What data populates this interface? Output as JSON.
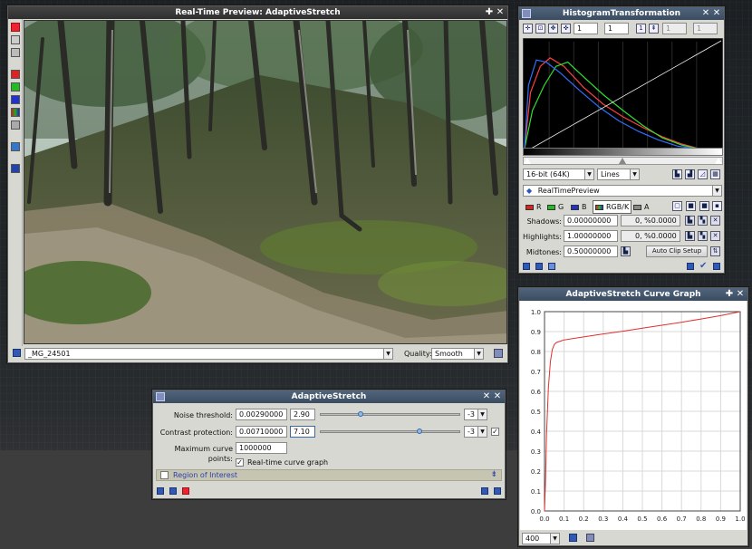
{
  "preview": {
    "title": "Real-Time Preview: AdaptiveStretch",
    "image_name": "_MG_24501",
    "quality_label": "Quality:",
    "quality_value": "Smooth"
  },
  "histogram": {
    "title": "HistogramTransformation",
    "zoom_h": "1",
    "zoom_v": "1",
    "zoom_h2": "1",
    "zoom_v2": "1",
    "bit_depth": "16-bit (64K)",
    "plot_mode": "Lines",
    "view": "RealTimePreview",
    "channels": [
      "R",
      "G",
      "B",
      "RGB/K",
      "A"
    ],
    "shadows_label": "Shadows:",
    "shadows_value": "0.00000000",
    "shadows_clip": "0, %0.0000",
    "highlights_label": "Highlights:",
    "highlights_value": "1.00000000",
    "highlights_clip": "0, %0.0000",
    "midtones_label": "Midtones:",
    "midtones_value": "0.50000000",
    "auto_clip_button": "Auto Clip Setup"
  },
  "adaptive": {
    "title": "AdaptiveStretch",
    "noise_label": "Noise threshold:",
    "noise_value": "0.00290000",
    "noise_mantissa": "2.90",
    "noise_exp": "-3",
    "noise_level": 0.29,
    "contrast_label": "Contrast protection:",
    "contrast_value": "0.00710000",
    "contrast_mantissa": "7.10",
    "contrast_exp": "-3",
    "contrast_level": 0.71,
    "max_points_label": "Maximum curve points:",
    "max_points_value": "1000000",
    "realtime_graph_label": "Real-time curve graph",
    "roi_label": "Region of Interest"
  },
  "curve_graph": {
    "title": "AdaptiveStretch Curve Graph",
    "size_value": "400",
    "y_ticks": [
      "1.0",
      "0.9",
      "0.8",
      "0.7",
      "0.6",
      "0.5",
      "0.4",
      "0.3",
      "0.2",
      "0.1",
      "0.0"
    ],
    "x_ticks": [
      "0.0",
      "0.1",
      "0.2",
      "0.3",
      "0.4",
      "0.5",
      "0.6",
      "0.7",
      "0.8",
      "0.9",
      "1.0"
    ],
    "curve_color": "#e03030"
  },
  "chart_data": {
    "type": "line",
    "title": "",
    "xlabel": "",
    "ylabel": "",
    "xlim": [
      0,
      1
    ],
    "ylim": [
      0,
      1
    ],
    "grid": true,
    "series": [
      {
        "x": [
          0.0,
          0.005,
          0.01,
          0.02,
          0.03,
          0.04,
          0.05,
          0.06,
          0.08,
          0.1,
          0.2,
          0.3,
          0.4,
          0.5,
          0.6,
          0.7,
          0.8,
          0.9,
          1.0
        ],
        "y": [
          0.0,
          0.15,
          0.38,
          0.62,
          0.75,
          0.81,
          0.835,
          0.845,
          0.852,
          0.858,
          0.873,
          0.888,
          0.902,
          0.917,
          0.932,
          0.947,
          0.963,
          0.98,
          1.0
        ]
      }
    ]
  },
  "histogram_chart": {
    "type": "line",
    "xlim": [
      0,
      1
    ],
    "ylim": [
      0,
      1
    ],
    "series": [
      {
        "name": "R",
        "color": "#ff4040",
        "x": [
          0,
          0.03,
          0.08,
          0.13,
          0.2,
          0.3,
          0.4,
          0.5,
          0.6,
          0.7,
          0.8,
          0.9,
          1.0
        ],
        "y": [
          0.02,
          0.55,
          0.8,
          0.88,
          0.8,
          0.6,
          0.44,
          0.32,
          0.22,
          0.13,
          0.06,
          0.01,
          0.0
        ]
      },
      {
        "name": "G",
        "color": "#30e030",
        "x": [
          0,
          0.04,
          0.1,
          0.16,
          0.22,
          0.3,
          0.4,
          0.5,
          0.6,
          0.7,
          0.8,
          0.9,
          1.0
        ],
        "y": [
          0.02,
          0.38,
          0.62,
          0.8,
          0.84,
          0.7,
          0.53,
          0.38,
          0.24,
          0.12,
          0.05,
          0.01,
          0.0
        ]
      },
      {
        "name": "B",
        "color": "#3070ff",
        "x": [
          0,
          0.02,
          0.06,
          0.11,
          0.18,
          0.28,
          0.38,
          0.48,
          0.58,
          0.68,
          0.78,
          0.9,
          1.0
        ],
        "y": [
          0.02,
          0.62,
          0.86,
          0.84,
          0.74,
          0.57,
          0.41,
          0.28,
          0.18,
          0.1,
          0.04,
          0.01,
          0.0
        ]
      }
    ]
  }
}
